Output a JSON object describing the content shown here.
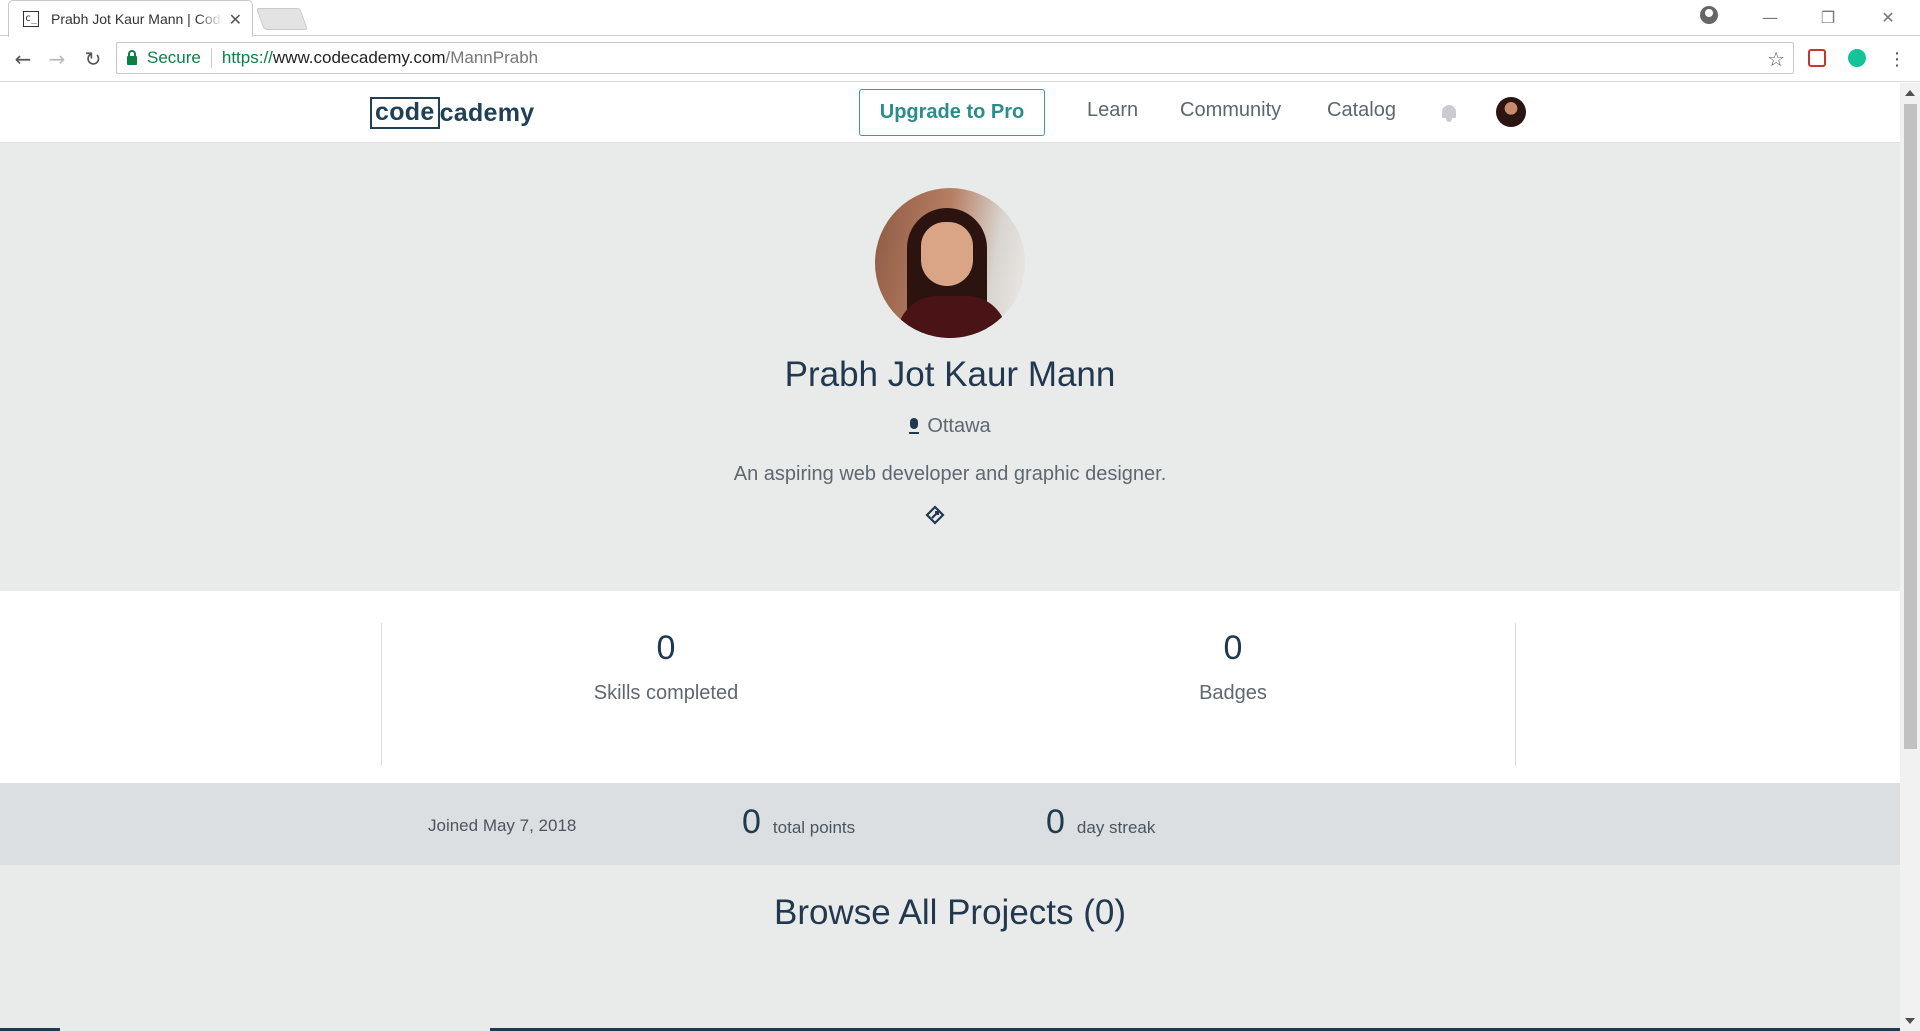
{
  "browser": {
    "tab_title": "Prabh Jot Kaur Mann | Codecademy",
    "favicon_text": "c_",
    "url_scheme": "https://",
    "url_host": "www.codecademy.com",
    "url_path": "/MannPrabh",
    "secure_label": "Secure"
  },
  "header": {
    "logo_code": "code",
    "logo_cademy": "cademy",
    "upgrade_label": "Upgrade to Pro",
    "nav": [
      "Learn",
      "Community",
      "Catalog"
    ]
  },
  "profile": {
    "name": "Prabh Jot Kaur Mann",
    "location": "Ottawa",
    "bio": "An aspiring web developer and graphic designer."
  },
  "stats": {
    "skills_completed": "0",
    "skills_label": "Skills completed",
    "badges": "0",
    "badges_label": "Badges"
  },
  "summary": {
    "joined": "Joined May 7, 2018",
    "total_points": "0",
    "total_points_label": "total points",
    "day_streak": "0",
    "day_streak_label": "day streak"
  },
  "projects": {
    "title": "Browse All Projects (0)"
  },
  "colors": {
    "brand_navy": "#204056",
    "accent_teal": "#2a8d8b",
    "hero_bg": "#e9ebeb",
    "summary_bg": "#dcdfe1",
    "secure_green": "#0b8043"
  }
}
